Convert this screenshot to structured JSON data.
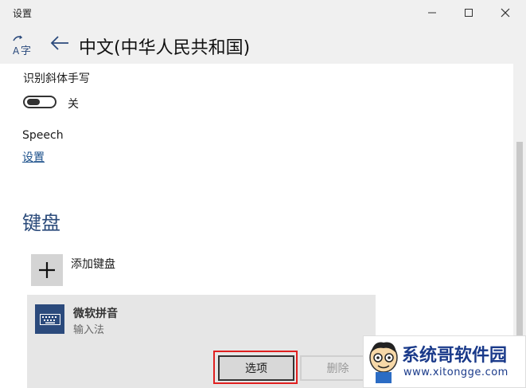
{
  "window": {
    "title": "设置"
  },
  "header": {
    "page_title": "中文(中华人民共和国)"
  },
  "handwriting": {
    "label": "识别斜体手写",
    "toggle_state": "关",
    "toggle_on": false
  },
  "speech": {
    "label": "Speech",
    "link": "设置"
  },
  "keyboard": {
    "heading": "键盘",
    "add_label": "添加键盘",
    "items": [
      {
        "name": "微软拼音",
        "type": "输入法"
      }
    ],
    "options_button": "选项",
    "delete_button": "删除"
  },
  "watermark": {
    "title": "系统哥软件园",
    "url": "www.xitongge.com"
  },
  "colors": {
    "accent": "#2b4a7c",
    "highlight_outline": "#e02020"
  }
}
